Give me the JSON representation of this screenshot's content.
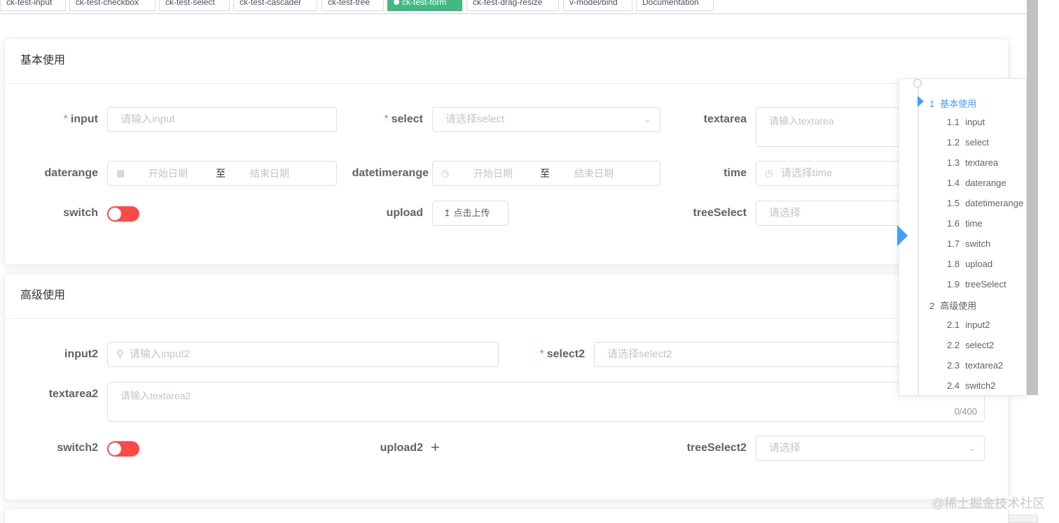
{
  "tabs": [
    {
      "label": "ck-test-input",
      "active": false
    },
    {
      "label": "ck-test-checkbox",
      "active": false
    },
    {
      "label": "ck-test-select",
      "active": false
    },
    {
      "label": "ck-test-cascader",
      "active": false
    },
    {
      "label": "ck-test-tree",
      "active": false
    },
    {
      "label": "ck-test-form",
      "active": true
    },
    {
      "label": "ck-test-drag-resize",
      "active": false
    },
    {
      "label": "v-model/bind",
      "active": false
    },
    {
      "label": "Documentation",
      "active": false
    }
  ],
  "basic": {
    "title": "基本使用",
    "input_label": "input",
    "input_placeholder": "请输入input",
    "select_label": "select",
    "select_placeholder": "请选择select",
    "textarea_label": "textarea",
    "textarea_placeholder": "请输入textarea",
    "daterange_label": "daterange",
    "daterange_start": "开始日期",
    "daterange_sep": "至",
    "daterange_end": "结束日期",
    "datetimerange_label": "datetimerange",
    "datetimerange_start": "开始日期",
    "datetimerange_sep": "至",
    "datetimerange_end": "结束日期",
    "time_label": "time",
    "time_placeholder": "请选择time",
    "switch_label": "switch",
    "switch_on": false,
    "upload_label": "upload",
    "upload_button": "点击上传",
    "treeselect_label": "treeSelect",
    "treeselect_placeholder": "请选择"
  },
  "advanced": {
    "title": "高级使用",
    "input2_label": "input2",
    "input2_placeholder": "请输入input2",
    "select2_label": "select2",
    "select2_placeholder": "请选择select2",
    "textarea2_label": "textarea2",
    "textarea2_placeholder": "请输入textarea2",
    "textarea2_count": "0/400",
    "switch2_label": "switch2",
    "switch2_on": false,
    "upload2_label": "upload2",
    "upload2_plus": "+",
    "treeselect2_label": "treeSelect2",
    "treeselect2_placeholder": "请选择"
  },
  "anchor": {
    "items": [
      {
        "num": "1",
        "label": "基本使用",
        "active": true,
        "level": 1
      },
      {
        "num": "1.1",
        "label": "input",
        "level": 2
      },
      {
        "num": "1.2",
        "label": "select",
        "level": 2
      },
      {
        "num": "1.3",
        "label": "textarea",
        "level": 2
      },
      {
        "num": "1.4",
        "label": "daterange",
        "level": 2
      },
      {
        "num": "1.5",
        "label": "datetimerange",
        "level": 2
      },
      {
        "num": "1.6",
        "label": "time",
        "level": 2
      },
      {
        "num": "1.7",
        "label": "switch",
        "level": 2
      },
      {
        "num": "1.8",
        "label": "upload",
        "level": 2
      },
      {
        "num": "1.9",
        "label": "treeSelect",
        "level": 2
      },
      {
        "num": "2",
        "label": "高级使用",
        "level": 1
      },
      {
        "num": "2.1",
        "label": "input2",
        "level": 2
      },
      {
        "num": "2.2",
        "label": "select2",
        "level": 2
      },
      {
        "num": "2.3",
        "label": "textarea2",
        "level": 2
      },
      {
        "num": "2.4",
        "label": "switch2",
        "level": 2
      }
    ]
  },
  "watermark": "@稀土掘金技术社区",
  "colors": {
    "accent": "#409eff",
    "active_tab": "#42b983",
    "required": "#f56c6c",
    "switch_off": "#ff4949"
  }
}
